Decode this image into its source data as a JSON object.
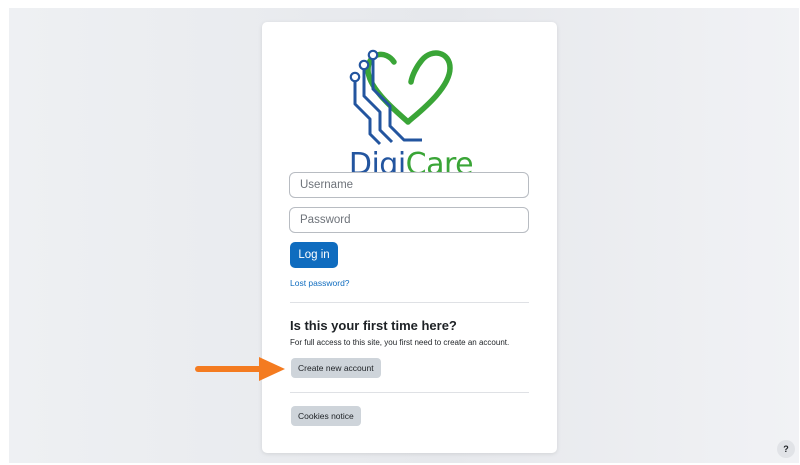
{
  "brand": {
    "name_part1": "Digi",
    "name_part2": "Care",
    "color_blue": "#23559f",
    "color_green": "#3aa537"
  },
  "login_form": {
    "username_placeholder": "Username",
    "password_placeholder": "Password",
    "login_label": "Log in",
    "lost_password_label": "Lost password?"
  },
  "signup": {
    "heading": "Is this your first time here?",
    "description": "For full access to this site, you first need to create an account.",
    "create_account_label": "Create new account"
  },
  "footer": {
    "cookies_label": "Cookies notice",
    "help_label": "?"
  },
  "annotation": {
    "arrow_color": "#f47b20",
    "arrow_target": "create-account-button"
  },
  "colors": {
    "primary": "#0f6cbf",
    "secondary_button": "#ced4da"
  }
}
